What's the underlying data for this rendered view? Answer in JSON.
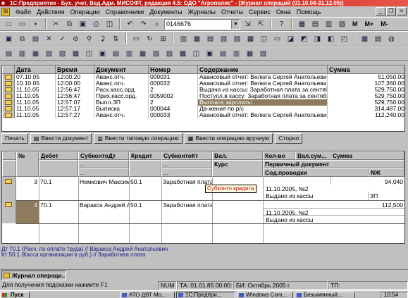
{
  "title": "1С:Предприятие - Бух. учет, Вед.Адм. МИСОФТ, редакция 4.5: ОДО \"Агрополис\" - [Журнал операций (01.10.04-31.12.05)]",
  "menu": [
    "Файл",
    "Действия",
    "Операции",
    "Справочники",
    "Документы",
    "Журналы",
    "Отчеты",
    "Сервис",
    "Окна",
    "Помощь"
  ],
  "toolbar1": {
    "search_value": "0146676",
    "labels": [
      "M",
      "M+",
      "M-"
    ]
  },
  "journal": {
    "columns": [
      "Дата",
      "Время",
      "Документ",
      "Номер",
      "Содержание",
      "Сумма"
    ],
    "rows": [
      [
        "07.10.05",
        "12:00:20",
        "Аванс.отч.",
        "000031",
        "Авансовый отчет: Велюга Сергей Анатольевич",
        "51,050.00"
      ],
      [
        "10.10.05",
        "12:00:00",
        "Аванс.отч.",
        "000032",
        "Авансовый отчет: Велюга Сергей Анатольевич",
        "107,360.00"
      ],
      [
        "11.10.05",
        "12:56:47",
        "Расх.касс.орд.",
        "2",
        "Выдача из кассы: Заработная плата за сентябрь",
        "529,750.00"
      ],
      [
        "11.10.05",
        "12:56:47",
        "Прих.касс.орд.",
        "0059002",
        "Поступл.в кассу: Заработная плата за сентябрь",
        "529,750.00"
      ],
      [
        "11.10.05",
        "12:57:07",
        "Выпл.ЗП",
        "2",
        "Выплата зарплаты",
        "529,750.00"
      ],
      [
        "11.10.05",
        "12:57:17",
        "Выписка",
        "000044",
        "Дв-жения по р/с",
        "314,487.00"
      ],
      [
        "11.10.05",
        "12:57:27",
        "Аванс.отч.",
        "000033",
        "Авансовый отчет: Велюга Сергей Анатольевич",
        "112,240.00"
      ]
    ]
  },
  "buttons": {
    "print": "Печать",
    "enter_document": "Ввести документ",
    "enter_typical": "Ввести типовую операцию",
    "enter_manual": "Ввести операцию вручную",
    "storno": "Сторно"
  },
  "entries": {
    "headers": {
      "num": "№",
      "debit": "Дебет",
      "subkonto_dt": "СубконтоДт",
      "credit": "Кредит",
      "subkonto_kt": "СубконтоКт",
      "currency": "Вал.",
      "rate": "Курс",
      "qty": "Кол-во",
      "cur_sum": "Вал.сум...",
      "sum": "Сумма",
      "primary_doc": "Первичный документ",
      "content": "Сод.проводки",
      "nzh": "NЖ",
      "dots": "..."
    },
    "rows": [
      {
        "num": "3",
        "debit": "70.1",
        "subkonto_dt": "Немкович Максим",
        "credit": "50.1",
        "subkonto_kt": "Заработная плата",
        "sum": "94,040",
        "primary_doc": "11.10.2005, №2",
        "content": "Выдано из кассы",
        "nzh": "ЗП"
      },
      {
        "num": "4",
        "debit": "70.1",
        "subkonto_dt": "Варакса Андрей А.",
        "credit": "50.1",
        "subkonto_kt": "Заработная плата",
        "sum": "112,500",
        "primary_doc": "11.10.2005, №2",
        "content": "Выдано из кассы",
        "nzh": "ЗП"
      }
    ],
    "tooltip": "Субконто кредита"
  },
  "status_lines": {
    "dt": "Дт 70.1 (Расч. по оплате труда) // Варакса Андрей Анатольевич",
    "kt": "Кт 50.1 (Касса организации в руб.) // Заработная плата"
  },
  "mdi_tab": "Журнал операци...",
  "statusbar": {
    "hint": "Для получения подсказки нажмите F1",
    "num": "NUM",
    "ta": "ТА: 01.01.85  00:00:00",
    "bi": "БИ: Октябрь 2005 г.",
    "tp": "ТП:"
  },
  "taskbar": {
    "start": "Пуск",
    "items": [
      "АТО ДВТ Мо...",
      "1С:Предпри...",
      "Windows Com...",
      "Безымянный..."
    ],
    "clock": "10:54"
  }
}
